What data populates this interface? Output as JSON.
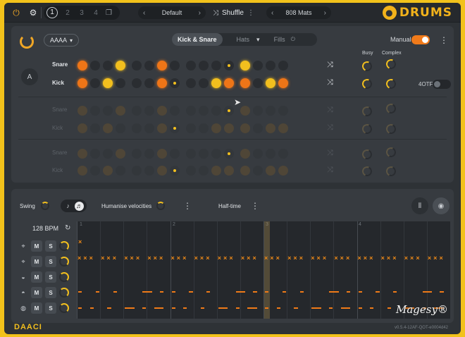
{
  "topbar": {
    "pages": [
      "1",
      "2",
      "3",
      "4"
    ],
    "preset_left": "Default",
    "shuffle_label": "Shuffle",
    "preset_right": "808 Mats",
    "brand": "DRUMS"
  },
  "generator": {
    "pattern_dropdown": "AAAA",
    "section_label": "A",
    "tabs": [
      "Kick & Snare",
      "Hats",
      "Fills"
    ],
    "manual_label": "Manual",
    "busy_label": "Busy",
    "complex_label": "Complex",
    "fourtf_label": "4OTF",
    "rows": [
      {
        "label": "Snare",
        "ghost": false
      },
      {
        "label": "Kick",
        "ghost": false
      },
      {
        "label": "Snare",
        "ghost": true
      },
      {
        "label": "Kick",
        "ghost": true
      },
      {
        "label": "Snare",
        "ghost": true
      },
      {
        "label": "Kick",
        "ghost": true
      }
    ],
    "snare_steps": [
      "o",
      "_",
      "_",
      "y",
      "_",
      "_",
      "o",
      "_",
      "_",
      "_",
      "_",
      "s",
      "y",
      "_",
      "_",
      "_"
    ],
    "kick_steps": [
      "o",
      "_",
      "y",
      "_",
      "_",
      "_",
      "o",
      "s",
      "_",
      "_",
      "y",
      "o",
      "o",
      "_",
      "y",
      "o"
    ]
  },
  "bottom": {
    "swing_label": "Swing",
    "humanise_label": "Humanise velocities",
    "halftime_label": "Half-time",
    "bpm": "128 BPM",
    "mute_label": "M",
    "solo_label": "S",
    "tracks": [
      "hat",
      "hat-open",
      "snare",
      "clap",
      "kick"
    ],
    "bar_numbers": [
      "1",
      "2",
      "3",
      "4"
    ]
  },
  "footer": {
    "brand": "DAACI",
    "version": "v0.5.4-12AF-QOT-e0004d42",
    "watermark": "Magesy®"
  },
  "colors": {
    "accent_orange": "#ee7517",
    "accent_yellow": "#f2bf1e",
    "frame": "#f2c21b",
    "panel": "#373b40"
  }
}
